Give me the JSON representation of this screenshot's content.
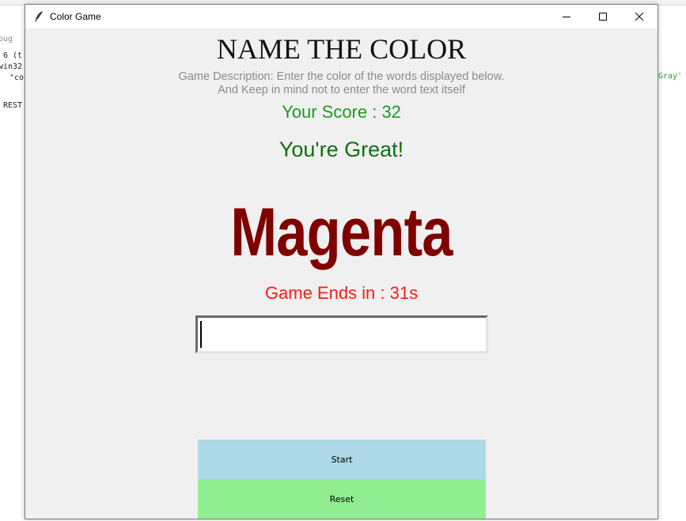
{
  "background_editor": {
    "lines": [
      {
        "text": "bug",
        "style": "gray"
      },
      {
        "text": "6 (t",
        "style": "plain"
      },
      {
        "text": "win32",
        "style": "plain"
      },
      {
        "text": "\"co",
        "style": "plain"
      },
      {
        "text": "REST",
        "style": "plain"
      }
    ],
    "right_fragment": "Gray'"
  },
  "window": {
    "title": "Color Game",
    "icon": "feather-icon",
    "controls": [
      "minimize-icon",
      "maximize-icon",
      "close-icon"
    ]
  },
  "game": {
    "heading": "NAME THE COLOR",
    "description_line1": "Game Description: Enter the color of the words displayed below.",
    "description_line2": "And Keep in mind not to enter the word text itself",
    "score_text": "Your Score : 32",
    "praise_text": "You're Great!",
    "color_word": "Magenta",
    "color_word_color": "#800000",
    "timer_text": "Game Ends in : 31s",
    "entry_value": "",
    "start_label": "Start",
    "reset_label": "Reset"
  },
  "colors": {
    "score": "#1e9a1e",
    "praise": "#107010",
    "timer": "#ff1a1a",
    "start_button": "#add8e6",
    "reset_button": "#90ee90",
    "window_background": "#f0f0f0"
  }
}
